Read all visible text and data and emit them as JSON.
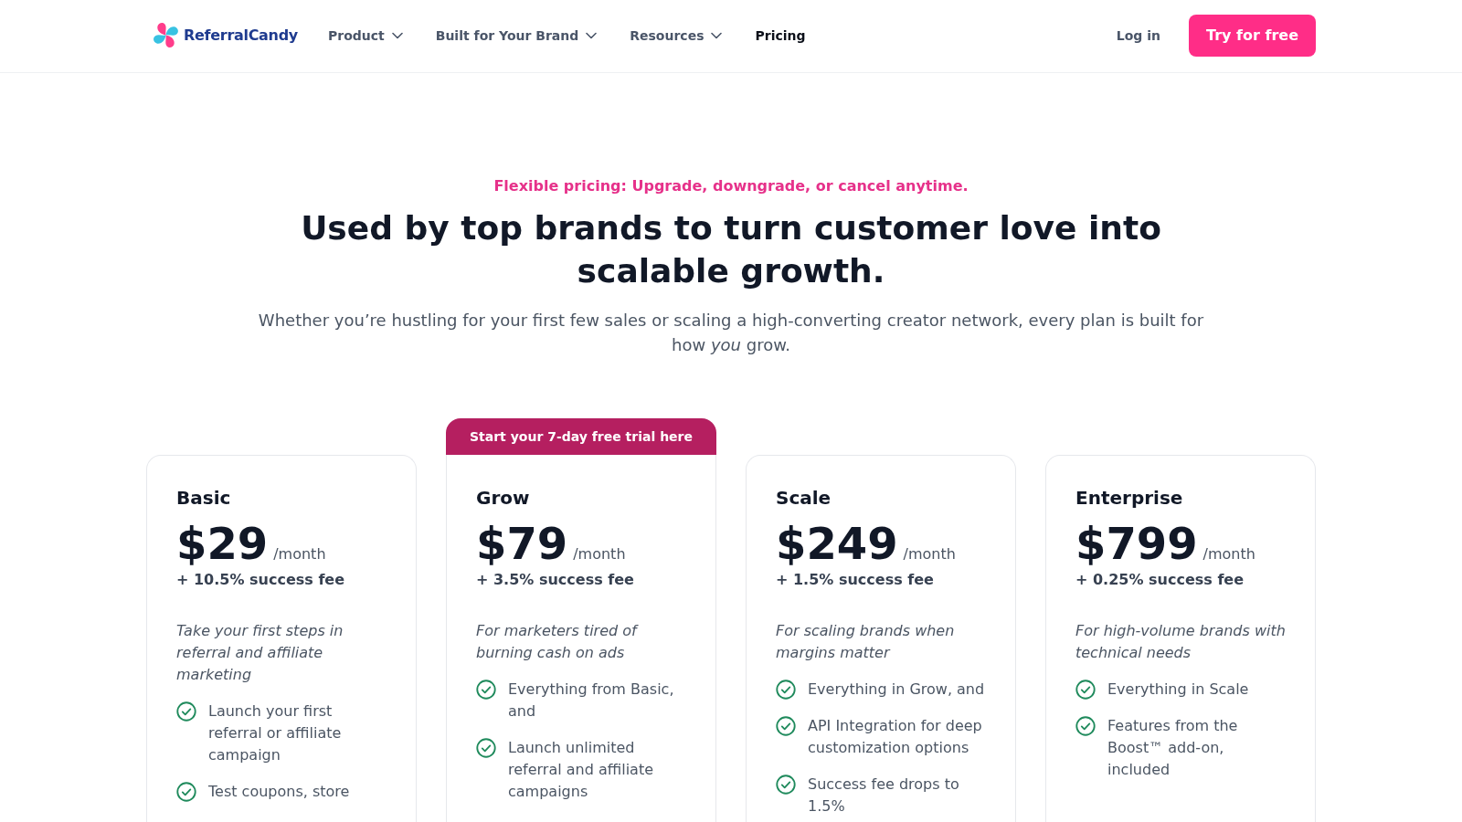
{
  "nav": {
    "logo": "ReferralCandy",
    "links": [
      {
        "label": "Product",
        "kind": "dropdown",
        "selected": false
      },
      {
        "label": "Built for Your Brand",
        "kind": "dropdown",
        "selected": false
      },
      {
        "label": "Resources",
        "kind": "dropdown",
        "selected": false
      },
      {
        "label": "Pricing",
        "kind": "link",
        "selected": true
      }
    ],
    "login": "Log in",
    "cta": "Try for free"
  },
  "hero": {
    "eyebrow": "Flexible pricing: Upgrade, downgrade, or cancel anytime.",
    "title": "Used by top brands to turn customer love into scalable growth.",
    "subtitle": "Whether you’re hustling for your first few sales or scaling a high-converting creator network, every plan is built for how *you* grow."
  },
  "plans": [
    {
      "name": "Basic",
      "price": "$29",
      "period": "/month",
      "fee": "+ 10.5% success fee",
      "description": "Take your first steps in referral and affiliate marketing",
      "features": [
        "Launch your first referral or affiliate campaign",
        "Test coupons, store"
      ]
    },
    {
      "badge": "Start your 7-day free trial here",
      "name": "Grow",
      "price": "$79",
      "period": "/month",
      "fee": "+ 3.5% success fee",
      "description": "For marketers tired of burning cash on ads",
      "features": [
        "Everything from Basic, and",
        "Launch unlimited referral and affiliate campaigns"
      ]
    },
    {
      "name": "Scale",
      "price": "$249",
      "period": "/month",
      "fee": "+ 1.5% success fee",
      "description": "For scaling brands when margins matter",
      "features": [
        "Everything in Grow, and",
        "API Integration for deep customization options",
        "Success fee drops to 1.5%"
      ]
    },
    {
      "name": "Enterprise",
      "price": "$799",
      "period": "/month",
      "fee": "+ 0.25% success fee",
      "description": "For high-volume brands with technical needs",
      "features": [
        "Everything in Scale",
        "Features from the Boost™ add-on, included"
      ]
    }
  ]
}
